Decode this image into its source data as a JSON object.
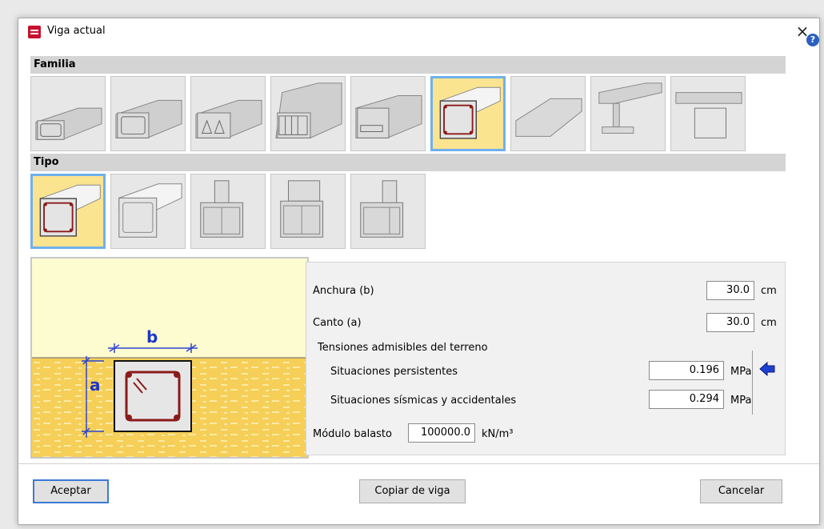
{
  "window": {
    "title": "Viga actual",
    "close_label": "×",
    "help_label": "?"
  },
  "sections": {
    "family_label": "Familia",
    "type_label": "Tipo"
  },
  "family_items": [
    {
      "icon": "beam-section-thumbnail-1",
      "selected": false
    },
    {
      "icon": "beam-section-thumbnail-2",
      "selected": false
    },
    {
      "icon": "beam-section-thumbnail-3",
      "selected": false
    },
    {
      "icon": "beam-section-thumbnail-4",
      "selected": false
    },
    {
      "icon": "beam-section-thumbnail-5",
      "selected": false
    },
    {
      "icon": "beam-section-thumbnail-6",
      "selected": true
    },
    {
      "icon": "beam-section-thumbnail-7",
      "selected": false
    },
    {
      "icon": "beam-section-thumbnail-8",
      "selected": false
    },
    {
      "icon": "beam-section-thumbnail-9",
      "selected": false
    }
  ],
  "type_items": [
    {
      "icon": "beam-type-thumbnail-1",
      "selected": true
    },
    {
      "icon": "beam-type-thumbnail-2",
      "selected": false
    },
    {
      "icon": "beam-type-thumbnail-3",
      "selected": false
    },
    {
      "icon": "beam-type-thumbnail-4",
      "selected": false
    },
    {
      "icon": "beam-type-thumbnail-5",
      "selected": false
    }
  ],
  "drawing": {
    "width_label": "b",
    "depth_label": "a"
  },
  "params": {
    "width": {
      "label": "Anchura (b)",
      "value": "30.0",
      "unit": "cm"
    },
    "depth": {
      "label": "Canto (a)",
      "value": "30.0",
      "unit": "cm"
    },
    "soil_group_label": "Tensiones admisibles del terreno",
    "persistent": {
      "label": "Situaciones persistentes",
      "value": "0.196",
      "unit": "MPa"
    },
    "seismic": {
      "label": "Situaciones sísmicas y accidentales",
      "value": "0.294",
      "unit": "MPa"
    },
    "modulus": {
      "label": "Módulo balasto",
      "value": "100000.0",
      "unit": "kN/m³"
    }
  },
  "buttons": {
    "accept": "Aceptar",
    "copy": "Copiar de viga",
    "cancel": "Cancelar"
  },
  "colors": {
    "selected_border": "#6fb0ee",
    "selected_fill": "#fbe48f",
    "arrow": "#1f3fd0",
    "rebar": "#8b1a1a"
  }
}
